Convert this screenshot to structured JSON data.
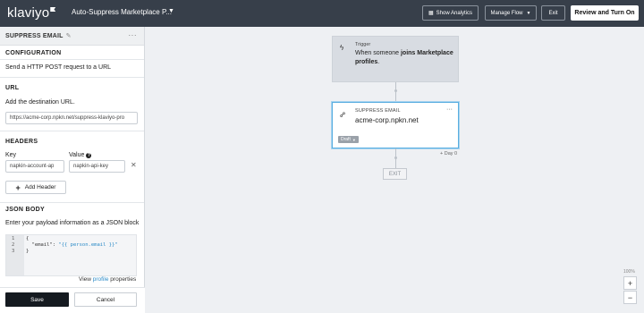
{
  "topbar": {
    "logo": "klaviyo",
    "flow_title": "Auto-Suppress Marketplace P...",
    "show_analytics": "Show Analytics",
    "manage_flow": "Manage Flow",
    "exit": "Exit",
    "review_turn_on": "Review and Turn On"
  },
  "panel": {
    "title": "SUPPRESS EMAIL",
    "configuration": "CONFIGURATION",
    "config_desc": "Send a HTTP POST request to a URL",
    "url_heading": "URL",
    "url_desc": "Add the destination URL.",
    "url_value": "https://acme-corp.npkn.net/suppress-klaviyo-pro",
    "headers_heading": "HEADERS",
    "key_label": "Key",
    "value_label": "Value",
    "header_key": "napkin-account-ap",
    "header_value": "napkin-api-key",
    "add_header": "Add Header",
    "json_heading": "JSON BODY",
    "json_desc": "Enter your payload information as a JSON block",
    "code_lines": [
      {
        "n": "1",
        "text": "{"
      },
      {
        "n": "2",
        "key": "  \"email\": ",
        "val": "\"{{ person.email }}\""
      },
      {
        "n": "3",
        "text": "}"
      }
    ],
    "view_prefix": "View ",
    "view_link": "profile",
    "view_suffix": " properties",
    "save": "Save",
    "cancel": "Cancel"
  },
  "canvas": {
    "trigger_label": "Trigger",
    "trigger_pre": "When someone ",
    "trigger_bold": "joins Marketplace profiles",
    "trigger_post": ".",
    "action_label": "SUPPRESS EMAIL",
    "action_host": "acme-corp.npkn.net",
    "draft": "Draft",
    "day": "+ Day 0",
    "exit": "EXIT",
    "zoom": "100%"
  }
}
